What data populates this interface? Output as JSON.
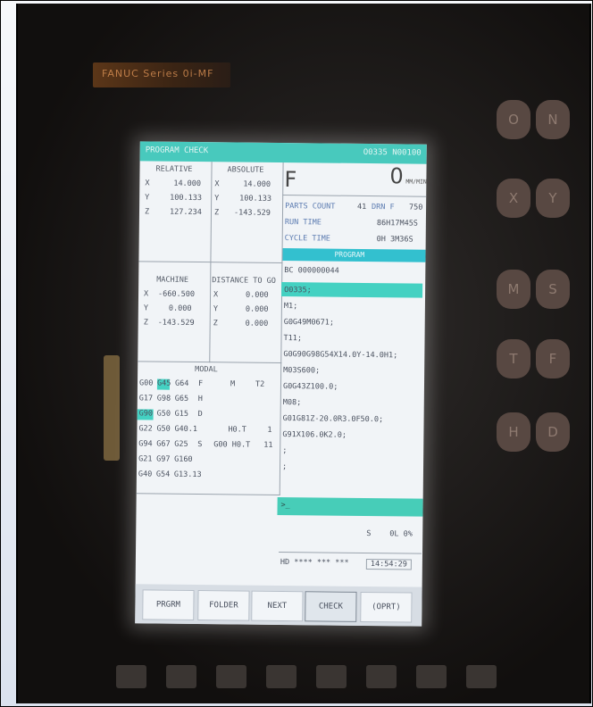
{
  "screen": {
    "title_left": "PROGRAM CHECK",
    "title_right": "O0335 N00100",
    "relative": {
      "header": "RELATIVE",
      "rows": [
        {
          "axis": "X",
          "value": "14.000"
        },
        {
          "axis": "Y",
          "value": "100.133"
        },
        {
          "axis": "Z",
          "value": "127.234"
        }
      ]
    },
    "absolute": {
      "header": "ABSOLUTE",
      "rows": [
        {
          "axis": "X",
          "value": "14.000"
        },
        {
          "axis": "Y",
          "value": "100.133"
        },
        {
          "axis": "Z",
          "value": "-143.529"
        }
      ]
    },
    "machine": {
      "header": "MACHINE",
      "rows": [
        {
          "axis": "X",
          "value": "-660.500"
        },
        {
          "axis": "Y",
          "value": "0.000"
        },
        {
          "axis": "Z",
          "value": "-143.529"
        }
      ]
    },
    "distance": {
      "header": "DISTANCE TO GO",
      "rows": [
        {
          "axis": "X",
          "value": "0.000"
        },
        {
          "axis": "Y",
          "value": "0.000"
        },
        {
          "axis": "Z",
          "value": "0.000"
        }
      ]
    },
    "feed_label": "F",
    "feed_value": "0",
    "feed_unit": "MM/MIN",
    "parts_count_label": "PARTS COUNT",
    "parts_count_value": "41",
    "dwn_label": "DRN F",
    "dwn_value": "750",
    "run_time_label": "RUN TIME",
    "run_time_value": "86H17M45S",
    "cycle_time_label": "CYCLE TIME",
    "cycle_time_value": "0H 3M36S",
    "program_header": "PROGRAM",
    "program_id": "BC 000000044",
    "program_lines": [
      "O0335;",
      "M1;",
      "G0G49M0671;",
      "T11;",
      "G0G90G98G54X14.0Y-14.0H1;",
      "M03S600;",
      "G0G43Z100.0;",
      "M08;",
      "G01G81Z-20.0R3.0F50.0;",
      "G91X106.0K2.0;",
      ";",
      ";"
    ],
    "modal": {
      "header": "MODAL",
      "rows": [
        [
          "G00",
          "G45",
          "G64",
          "F",
          "M",
          "T2"
        ],
        [
          "G17",
          "G98",
          "G65",
          "H",
          "",
          ""
        ],
        [
          "G90",
          "G50",
          "G15",
          "D",
          "",
          ""
        ],
        [
          "G22",
          "G50",
          "G40.1",
          "",
          "H0.T",
          "1"
        ],
        [
          "G94",
          "G67",
          "G25",
          "S",
          "G00 H0.T",
          "11"
        ],
        [
          "G21",
          "G97",
          "G160",
          "",
          "",
          ""
        ],
        [
          "G40",
          "G54",
          "G13.13",
          "",
          "",
          ""
        ]
      ]
    },
    "cmd_line": ">_",
    "s_label": "S",
    "s_value": "0L 0%",
    "mode_text": "HD **** *** ***",
    "clock": "14:54:29",
    "softkeys": [
      "PRGRM",
      "FOLDER",
      "NEXT",
      "CHECK",
      "(OPRT)"
    ]
  },
  "photo": {
    "brand_text": "FANUC Series 0i-MF",
    "keypad_letters": [
      "O",
      "N",
      "X",
      "Y",
      "M",
      "S",
      "T",
      "F",
      "H",
      "D"
    ]
  }
}
